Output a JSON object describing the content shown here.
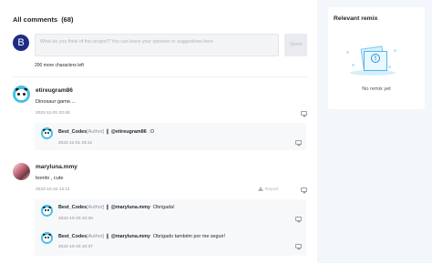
{
  "comments_header": {
    "title": "All comments",
    "count": "(68)"
  },
  "composer": {
    "avatar_letter": "B",
    "placeholder": "What do you think of this project? You can leave your opinions or suggestions here",
    "send_label": "Send",
    "chars_left": "200 more characters left"
  },
  "comments": [
    {
      "user": "etireugram86",
      "text": "Dinosaur game....",
      "date": "2022-11-01 03:48",
      "replies": [
        {
          "user": "Best_Codes",
          "author_tag": "[Author]",
          "separator": "❙",
          "mention": "@etireugram86",
          "text": ":D",
          "date": "2022-11-01 15:11"
        }
      ]
    },
    {
      "user": "maryluna.mmy",
      "text": "bonito , cute",
      "date": "2022-10-22 12:11",
      "report_label": "Report",
      "replies": [
        {
          "user": "Best_Codes",
          "author_tag": "[Author]",
          "separator": "❙",
          "mention": "@maryluna.mmy",
          "text": "Obrigada!",
          "date": "2022-10-23 10:36"
        },
        {
          "user": "Best_Codes",
          "author_tag": "[Author]",
          "separator": "❙",
          "mention": "@maryluna.mmy",
          "text": "Obrigado também por me seguir!",
          "date": "2022-10-23 10:37"
        }
      ]
    }
  ],
  "relevant_remix": {
    "title": "Relevant remix",
    "empty_icon_glyph": "!",
    "empty_text": "No remix yet"
  }
}
